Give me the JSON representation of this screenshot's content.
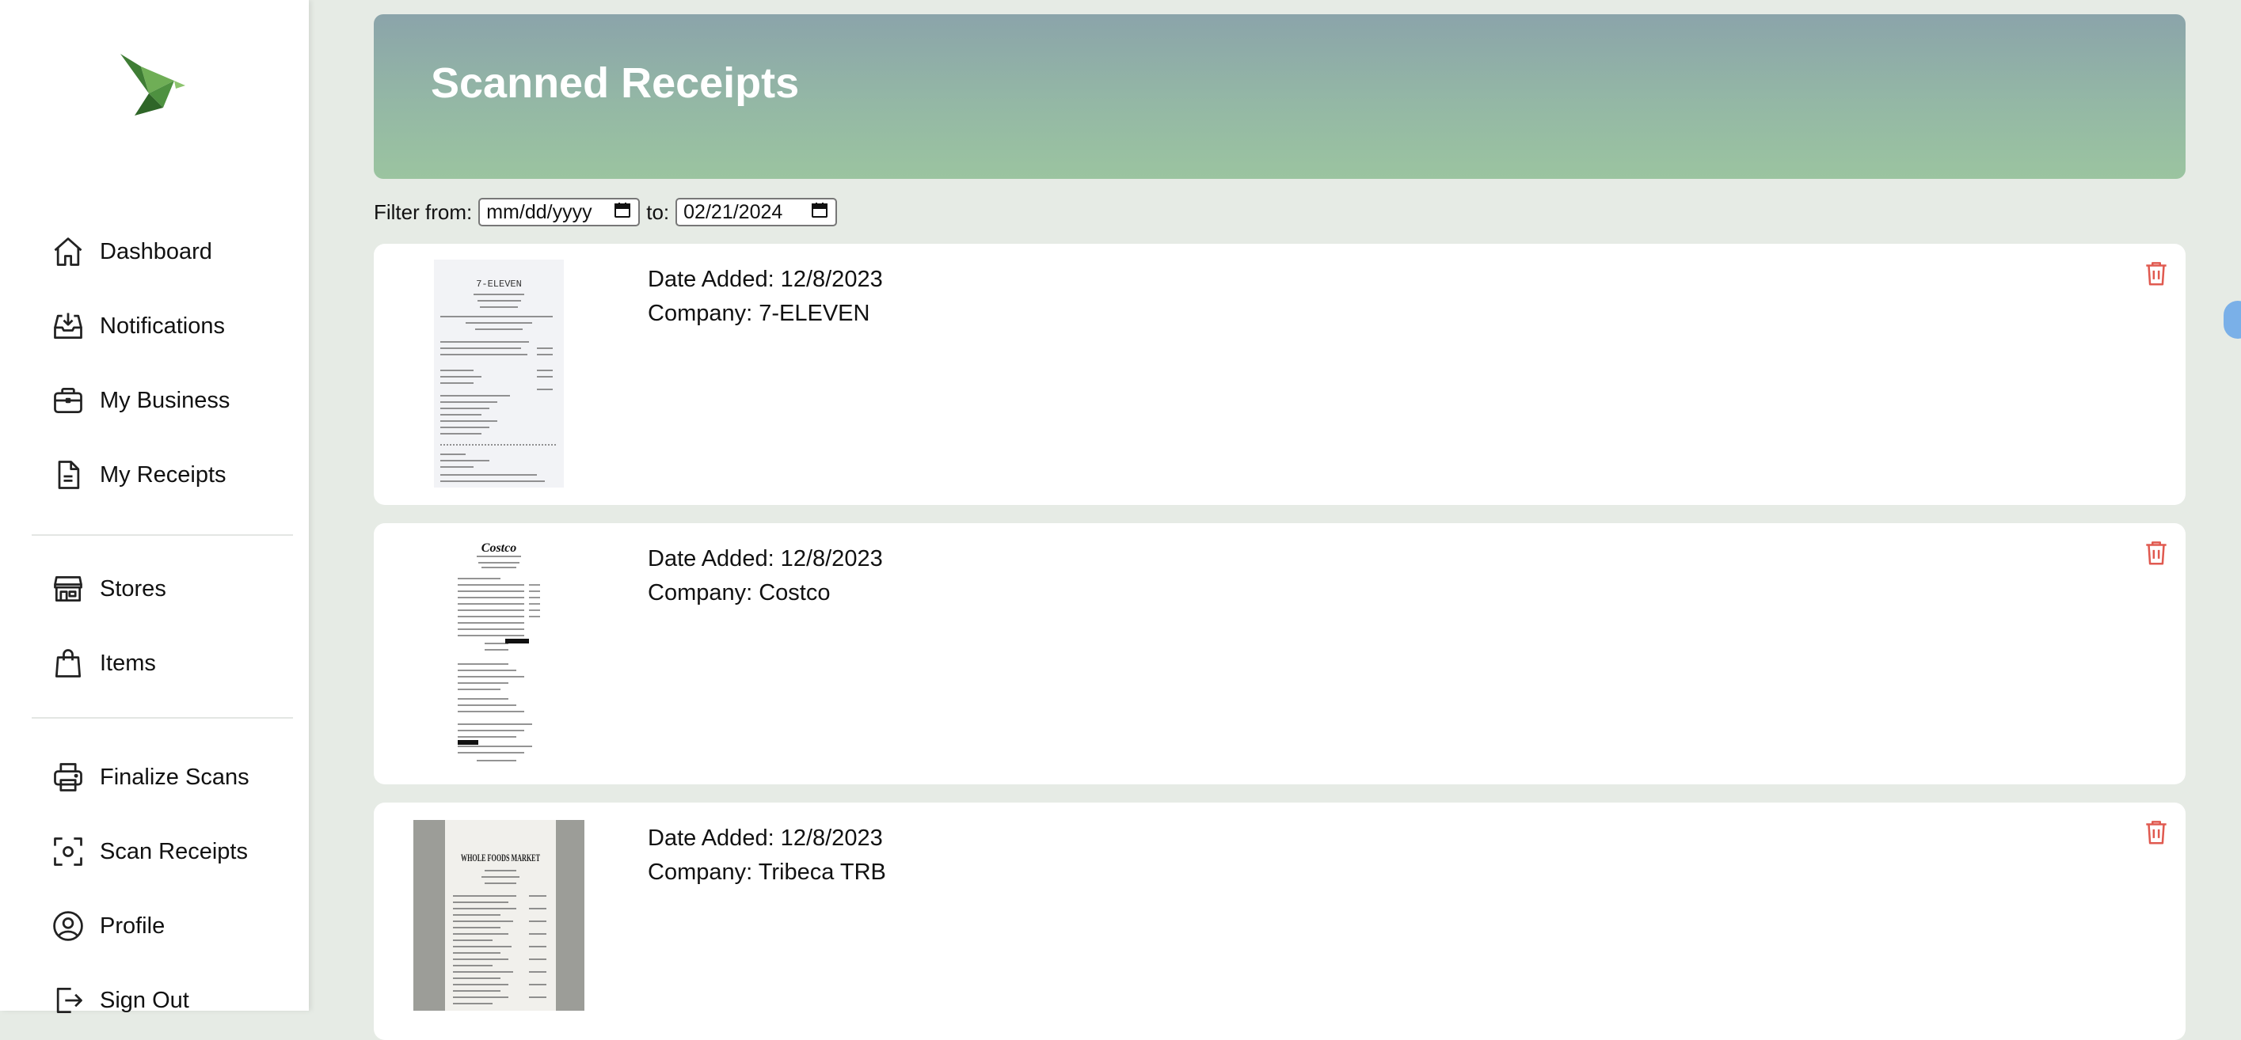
{
  "sidebar": {
    "logo": "bird-logo",
    "items": [
      {
        "label": "Dashboard",
        "icon": "home-icon"
      },
      {
        "label": "Notifications",
        "icon": "inbox-icon"
      },
      {
        "label": "My Business",
        "icon": "briefcase-icon"
      },
      {
        "label": "My Receipts",
        "icon": "document-icon"
      },
      {
        "label": "Stores",
        "icon": "store-icon"
      },
      {
        "label": "Items",
        "icon": "shopping-bag-icon"
      },
      {
        "label": "Finalize Scans",
        "icon": "printer-icon"
      },
      {
        "label": "Scan Receipts",
        "icon": "scan-icon"
      },
      {
        "label": "Profile",
        "icon": "user-circle-icon"
      },
      {
        "label": "Sign Out",
        "icon": "sign-out-icon"
      }
    ]
  },
  "header": {
    "title": "Scanned Receipts"
  },
  "filter": {
    "from_label": "Filter from:",
    "from_value": "mm/dd/yyyy",
    "to_label": "to:",
    "to_value": "02/21/2024"
  },
  "receipts": [
    {
      "date_added": "Date Added: 12/8/2023",
      "company": "Company: 7-ELEVEN",
      "receipt_heading": "7-ELEVEN"
    },
    {
      "date_added": "Date Added: 12/8/2023",
      "company": "Company: Costco",
      "receipt_heading": "Costco"
    },
    {
      "date_added": "Date Added: 12/8/2023",
      "company": "Company: Tribeca TRB",
      "receipt_heading": "WHOLE FOODS MARKET"
    }
  ],
  "colors": {
    "accent_green": "#5a9a4a",
    "banner_top": "#8ba4aa",
    "banner_bottom": "#9bc4a0",
    "trash_red": "#e05a50",
    "background": "#e6ebe5"
  }
}
